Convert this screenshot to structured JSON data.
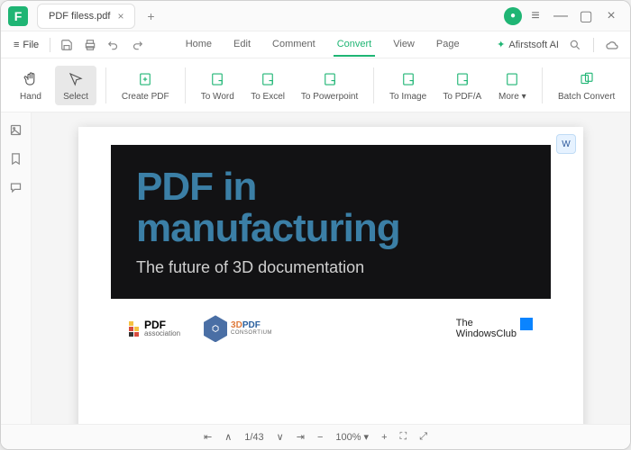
{
  "app": {
    "logo_letter": "F"
  },
  "tab": {
    "title": "PDF filess.pdf"
  },
  "menubar": {
    "file_label": "File",
    "tabs": [
      "Home",
      "Edit",
      "Comment",
      "Convert",
      "View",
      "Page"
    ],
    "active_index": 3,
    "ai_label": "Afirstsoft AI"
  },
  "toolbar": {
    "hand": "Hand",
    "select": "Select",
    "createpdf": "Create PDF",
    "toword": "To Word",
    "toexcel": "To Excel",
    "topowerpoint": "To Powerpoint",
    "toimage": "To Image",
    "topdfa": "To PDF/A",
    "more": "More",
    "batch": "Batch Convert"
  },
  "document": {
    "hero_title": "PDF in manufacturing",
    "hero_sub": "The future of 3D documentation",
    "pdf_assoc_bold": "PDF",
    "pdf_assoc_sub": "association",
    "cons_3d": "3D",
    "cons_pdf": "PDF",
    "cons_sub": "CONSORTIUM",
    "twc_line1": "The",
    "twc_line2": "WindowsClub"
  },
  "statusbar": {
    "page": "1/43",
    "zoom": "100%"
  }
}
